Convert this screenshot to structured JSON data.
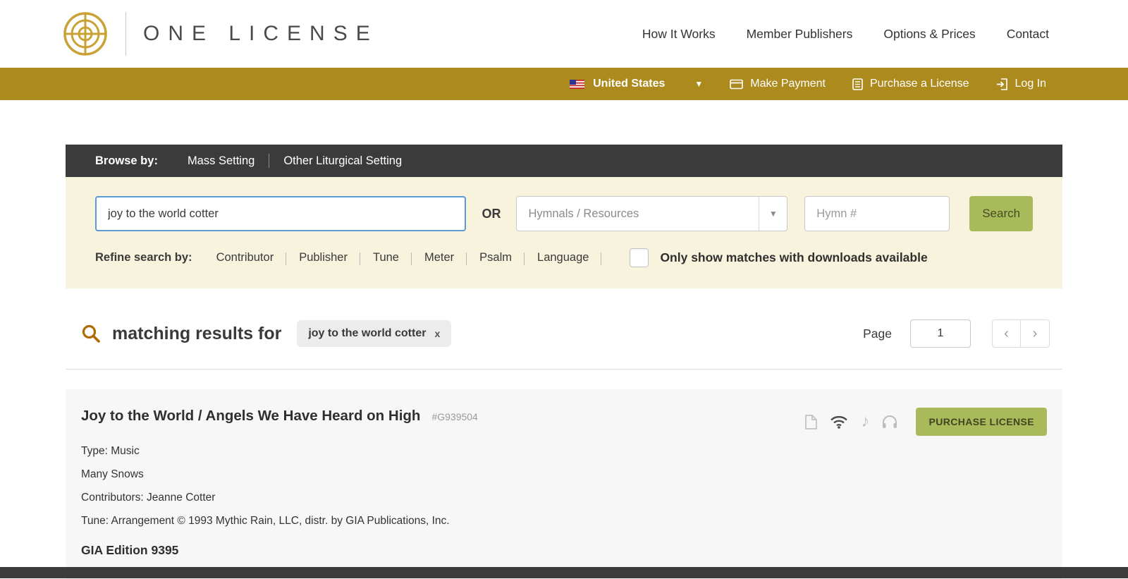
{
  "header": {
    "brand": "ONE LICENSE",
    "nav": [
      "How It Works",
      "Member Publishers",
      "Options & Prices",
      "Contact"
    ]
  },
  "utility": {
    "country": "United States",
    "make_payment": "Make Payment",
    "purchase_license": "Purchase a License",
    "log_in": "Log In"
  },
  "browse": {
    "label": "Browse by:",
    "links": [
      "Mass Setting",
      "Other Liturgical Setting"
    ]
  },
  "search": {
    "query_value": "joy to the world cotter",
    "or_label": "OR",
    "hymnal_placeholder": "Hymnals / Resources",
    "hymn_placeholder": "Hymn #",
    "search_button": "Search",
    "refine_label": "Refine search by:",
    "refine_links": [
      "Contributor",
      "Publisher",
      "Tune",
      "Meter",
      "Psalm",
      "Language"
    ],
    "downloads_label": "Only show matches with downloads available"
  },
  "results": {
    "heading": "matching results for",
    "chip_label": "joy to the world cotter",
    "chip_close": "x",
    "page_label": "Page",
    "page_value": "1",
    "prev": "‹",
    "next": "›"
  },
  "card": {
    "title": "Joy to the World / Angels We Have Heard on High",
    "ref": "#G939504",
    "type": "Type: Music",
    "collection": "Many Snows",
    "contributors": "Contributors: Jeanne Cotter",
    "tune": "Tune: Arrangement © 1993 Mythic Rain, LLC, distr. by GIA Publications, Inc.",
    "edition": "GIA Edition 9395",
    "purchase": "PURCHASE LICENSE",
    "music_note_glyph": "♪"
  },
  "colors": {
    "gold_bar": "#ad8a1e",
    "logo_gold": "#c9a236",
    "green_button": "#a9ba5a",
    "dark_bar": "#3b3b3b",
    "cream_panel": "#f8f3dd"
  }
}
